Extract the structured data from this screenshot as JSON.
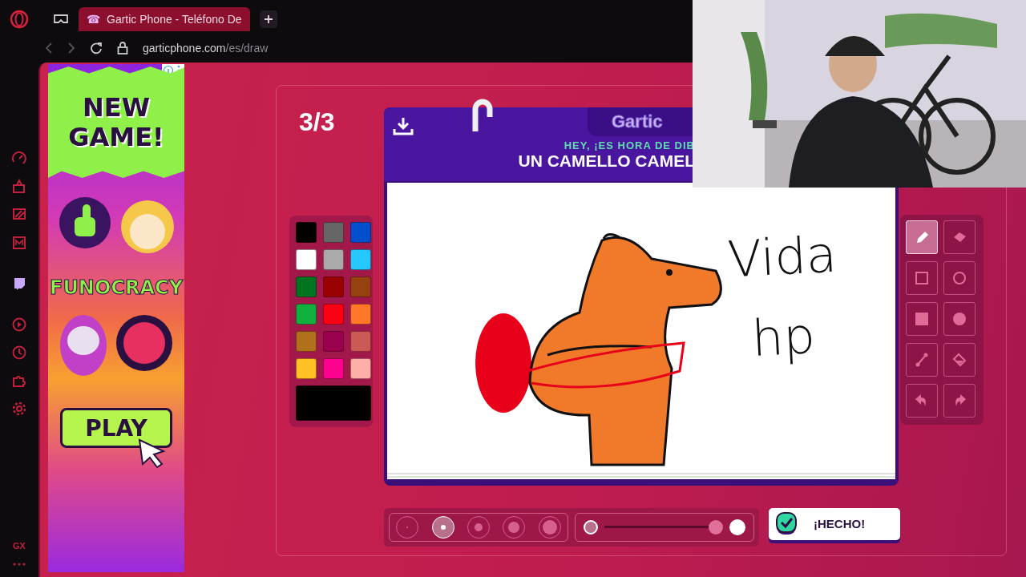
{
  "browser": {
    "tab": {
      "icon": "☎",
      "title": "Gartic Phone - Teléfono De"
    },
    "url": {
      "host": "garticphone.com",
      "path": "/es/draw"
    }
  },
  "sidebar": {
    "badge": "GX"
  },
  "ad": {
    "headline": "NEW GAME!",
    "brand": "FUNOCRACY",
    "cta": "PLAY"
  },
  "game": {
    "round": "3/3",
    "logo": "Gartic",
    "prompt_hint": "HEY, ¡ES HORA DE DIB",
    "prompt": "UN CAMELLO CAMEL",
    "palette": [
      {
        "color": "#000000"
      },
      {
        "color": "#666666"
      },
      {
        "color": "#0050cd"
      },
      {
        "color": "#ffffff"
      },
      {
        "color": "#aaaaaa"
      },
      {
        "color": "#26c9ff"
      },
      {
        "color": "#017420"
      },
      {
        "color": "#990000"
      },
      {
        "color": "#964112"
      },
      {
        "color": "#11b03c"
      },
      {
        "color": "#ff0013"
      },
      {
        "color": "#ff7829"
      },
      {
        "color": "#b0701c"
      },
      {
        "color": "#99004e"
      },
      {
        "color": "#cb5a57"
      },
      {
        "color": "#ffc126"
      },
      {
        "color": "#ff008f"
      },
      {
        "color": "#feafa8"
      }
    ],
    "current": {
      "color": "#000000"
    },
    "canvas_notes": [
      "Vida",
      "hp"
    ],
    "tools": [
      {
        "kind": "pencil",
        "selected": true
      },
      {
        "kind": "eraser",
        "selected": false
      },
      {
        "kind": "rectangle",
        "selected": false
      },
      {
        "kind": "ellipse",
        "selected": false
      },
      {
        "kind": "filled-rectangle",
        "selected": false
      },
      {
        "kind": "filled-ellipse",
        "selected": false
      },
      {
        "kind": "line",
        "selected": false
      },
      {
        "kind": "fill",
        "selected": false
      },
      {
        "kind": "undo",
        "selected": false
      },
      {
        "kind": "redo",
        "selected": false
      }
    ],
    "brush_sizes": [
      {
        "selected": false
      },
      {
        "selected": true
      },
      {
        "selected": false
      },
      {
        "selected": false
      },
      {
        "selected": false
      }
    ],
    "opacity": {
      "level": 1
    },
    "done_button": "¡HECHO!"
  }
}
